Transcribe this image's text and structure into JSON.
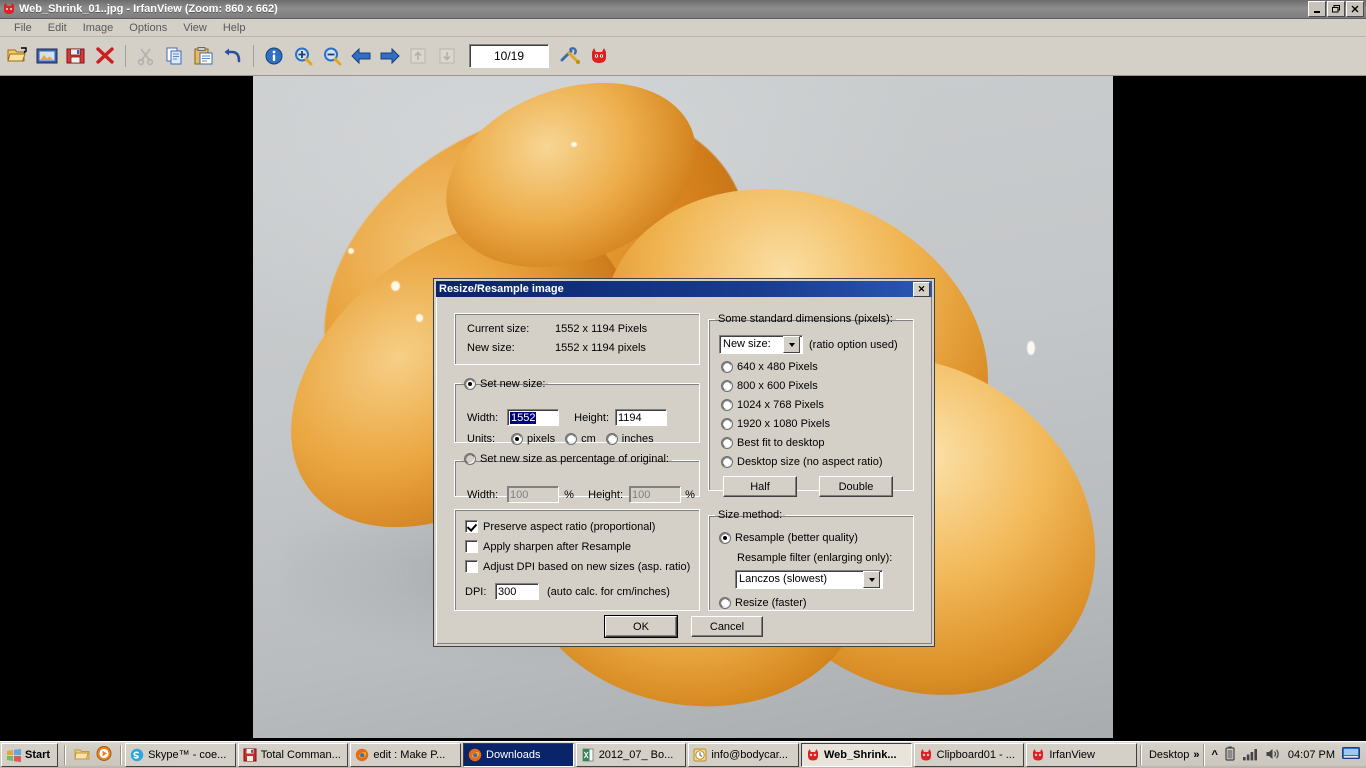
{
  "window": {
    "title": "Web_Shrink_01..jpg - IrfanView (Zoom: 860 x 662)",
    "icon": "irfanview-cat-icon",
    "minimize": "_",
    "restore": "❐",
    "close": "✕"
  },
  "menubar": {
    "items": [
      {
        "label": "File"
      },
      {
        "label": "Edit"
      },
      {
        "label": "Image"
      },
      {
        "label": "Options"
      },
      {
        "label": "View"
      },
      {
        "label": "Help"
      }
    ]
  },
  "toolbar": {
    "counter_value": "10/19",
    "buttons": [
      {
        "name": "open-icon"
      },
      {
        "name": "thumbnails-icon"
      },
      {
        "name": "save-icon"
      },
      {
        "name": "delete-icon"
      },
      {
        "name": "cut-icon"
      },
      {
        "name": "copy-icon"
      },
      {
        "name": "paste-icon"
      },
      {
        "name": "undo-icon"
      },
      {
        "name": "info-icon"
      },
      {
        "name": "zoom-in-icon"
      },
      {
        "name": "zoom-out-icon"
      },
      {
        "name": "previous-icon"
      },
      {
        "name": "next-icon"
      },
      {
        "name": "first-icon"
      },
      {
        "name": "last-icon"
      },
      {
        "name": "settings-icon"
      },
      {
        "name": "irfanview-icon"
      }
    ]
  },
  "dialog": {
    "title": "Resize/Resample image",
    "close_label": "✕",
    "current_size": {
      "label": "Current size:",
      "value": "1552  x  1194  Pixels"
    },
    "new_size": {
      "label": "New size:",
      "value": "1552  x  1194  pixels"
    },
    "set_new_size": {
      "legend": "Set new size:",
      "selected": true,
      "width_label": "Width:",
      "width_value": "1552",
      "height_label": "Height:",
      "height_value": "1194",
      "units_label": "Units:",
      "units": [
        {
          "label": "pixels",
          "selected": true
        },
        {
          "label": "cm",
          "selected": false
        },
        {
          "label": "inches",
          "selected": false
        }
      ]
    },
    "set_percentage": {
      "legend": "Set new size as percentage of original:",
      "selected": false,
      "width_label": "Width:",
      "width_value": "100",
      "width_unit": "%",
      "height_label": "Height:",
      "height_value": "100",
      "height_unit": "%"
    },
    "options": {
      "preserve_aspect": {
        "label": "Preserve aspect ratio (proportional)",
        "checked": true
      },
      "apply_sharpen": {
        "label": "Apply sharpen after Resample",
        "checked": false
      },
      "adjust_dpi": {
        "label": "Adjust DPI based on new sizes (asp. ratio)",
        "checked": false
      },
      "dpi_label": "DPI:",
      "dpi_value": "300",
      "dpi_note": "(auto calc. for cm/inches)"
    },
    "standard_dimensions": {
      "legend": "Some standard dimensions (pixels):",
      "combo_value": "New size:",
      "combo_note": "(ratio option used)",
      "options": [
        {
          "label": "640 x 480 Pixels",
          "selected": false
        },
        {
          "label": "800 x 600 Pixels",
          "selected": false
        },
        {
          "label": "1024 x 768 Pixels",
          "selected": false
        },
        {
          "label": "1920 x 1080 Pixels",
          "selected": false
        },
        {
          "label": "Best fit to desktop",
          "selected": false
        },
        {
          "label": "Desktop size (no aspect ratio)",
          "selected": false
        }
      ],
      "half_label": "Half",
      "double_label": "Double"
    },
    "size_method": {
      "legend": "Size method:",
      "resample": {
        "label": "Resample (better quality)",
        "selected": true
      },
      "filter_label": "Resample filter (enlarging only):",
      "filter_value": "Lanczos (slowest)",
      "resize": {
        "label": "Resize (faster)",
        "selected": false
      }
    },
    "ok_label": "OK",
    "cancel_label": "Cancel"
  },
  "taskbar": {
    "start_label": "Start",
    "quick_launch": [
      {
        "name": "show-desktop-icon"
      },
      {
        "name": "media-player-icon"
      }
    ],
    "tasks": [
      {
        "label": "Skype™ - coe...",
        "icon": "skype-icon",
        "state": "normal"
      },
      {
        "label": "Total Comman...",
        "icon": "total-commander-icon",
        "state": "normal"
      },
      {
        "label": "edit : Make P...",
        "icon": "firefox-icon",
        "state": "normal"
      },
      {
        "label": "Downloads",
        "icon": "firefox-icon",
        "state": "active"
      },
      {
        "label": "2012_07_ Bo...",
        "icon": "excel-icon",
        "state": "normal"
      },
      {
        "label": "info@bodycar...",
        "icon": "outlook-icon",
        "state": "normal"
      },
      {
        "label": "Web_Shrink...",
        "icon": "irfanview-icon",
        "state": "pressed"
      },
      {
        "label": "Clipboard01 - ...",
        "icon": "irfanview-icon",
        "state": "normal"
      },
      {
        "label": "IrfanView",
        "icon": "irfanview-icon",
        "state": "normal"
      }
    ],
    "deskband_label": "Desktop",
    "deskband_chevron": "»",
    "tray": {
      "expand": "«",
      "icons": [
        {
          "name": "battery-icon"
        },
        {
          "name": "signal-icon"
        },
        {
          "name": "volume-icon"
        }
      ],
      "clock": "04:07 PM",
      "show_desktop": "show-desktop-icon"
    }
  }
}
